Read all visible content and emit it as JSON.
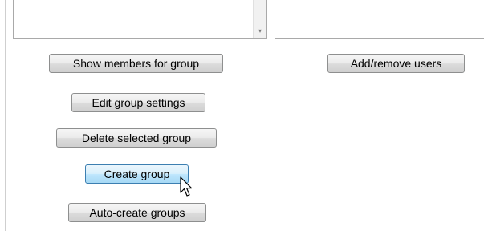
{
  "groups_panel": {
    "scroll_down_arrow": "▾",
    "show_members_label": "Show members for group",
    "edit_settings_label": "Edit group settings",
    "delete_group_label": "Delete selected group",
    "create_group_label": "Create group",
    "auto_create_label": "Auto-create groups"
  },
  "users_panel": {
    "add_remove_label": "Add/remove users"
  },
  "state": {
    "hovered_button": "Create group"
  },
  "colors": {
    "button_hover_border": "#3c7fb1",
    "button_hover_fill": "#bee6fd"
  },
  "icons": {
    "cursor": "mouse-pointer-arrow-icon"
  }
}
